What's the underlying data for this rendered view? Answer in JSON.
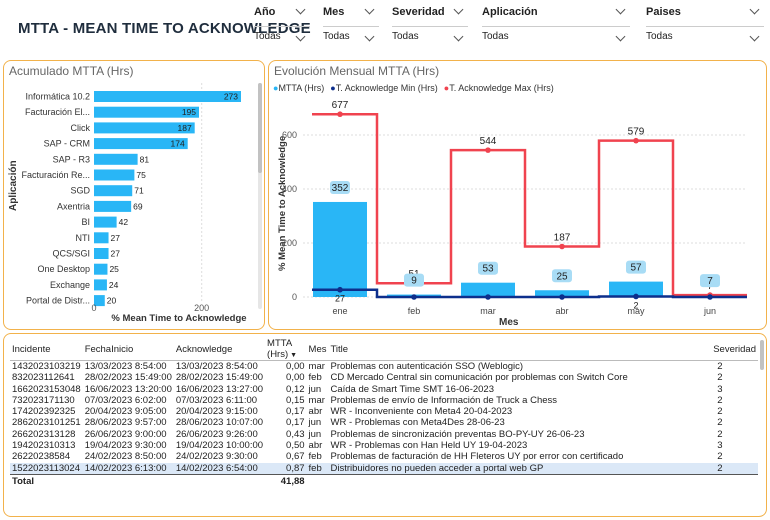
{
  "header": {
    "title": "MTTA - MEAN TIME TO ACKNOWLEDGE"
  },
  "filters": [
    {
      "label": "Año",
      "value": "Todas"
    },
    {
      "label": "Mes",
      "value": "Todas"
    },
    {
      "label": "Severidad",
      "value": "Todas"
    },
    {
      "label": "Aplicación",
      "value": "Todas"
    },
    {
      "label": "Paises",
      "value": "Todas"
    }
  ],
  "left_chart": {
    "title": "Acumulado MTTA (Hrs)",
    "ylabel": "Aplicación",
    "xlabel": "% Mean Time to Acknowledge",
    "ticks": [
      "0",
      "200"
    ]
  },
  "right_chart": {
    "title": "Evolución Mensual MTTA (Hrs)",
    "legend": [
      "MTTA (Hrs)",
      "T. Acknowledge Min (Hrs)",
      "T. Acknowledge Max (Hrs)"
    ],
    "ylabel": "% Mean Time to Acknowledge",
    "xlabel": "Mes",
    "yticks": [
      "0",
      "200",
      "400",
      "600"
    ]
  },
  "chart_data": [
    {
      "type": "bar",
      "orientation": "horizontal",
      "title": "Acumulado MTTA (Hrs)",
      "ylabel": "Aplicación",
      "xlabel": "% Mean Time to Acknowledge",
      "categories": [
        "Informática 10.2",
        "Facturación El...",
        "Click",
        "SAP - CRM",
        "SAP - R3",
        "Facturación Re...",
        "SGD",
        "Axentria",
        "BI",
        "NTI",
        "QCS/SGI",
        "One Desktop",
        "Exchange",
        "Portal de Distr..."
      ],
      "values": [
        273,
        195,
        187,
        174,
        81,
        75,
        71,
        69,
        42,
        27,
        27,
        25,
        24,
        20
      ],
      "xlim": [
        0,
        280
      ],
      "color": "#29b6f6"
    },
    {
      "type": "bar",
      "title": "Evolución Mensual MTTA (Hrs)",
      "xlabel": "Mes",
      "ylabel": "% Mean Time to Acknowledge",
      "categories": [
        "ene",
        "feb",
        "mar",
        "abr",
        "may",
        "jun"
      ],
      "series": [
        {
          "name": "MTTA (Hrs)",
          "type": "bar",
          "values": [
            352,
            9,
            53,
            25,
            57,
            7
          ],
          "color": "#29b6f6"
        },
        {
          "name": "T. Acknowledge Min (Hrs)",
          "type": "line",
          "values": [
            27,
            0,
            0,
            0,
            2,
            0
          ],
          "color": "#0d2f8c"
        },
        {
          "name": "T. Acknowledge Max (Hrs)",
          "type": "line",
          "values": [
            677,
            51,
            544,
            187,
            579,
            7
          ],
          "color": "#f0434f"
        }
      ],
      "ylim": [
        0,
        700
      ]
    }
  ],
  "table": {
    "headers": [
      "Incidente",
      "FechaInicio",
      "Acknowledge",
      "MTTA (Hrs)",
      "Mes",
      "Title",
      "Severidad"
    ],
    "rows": [
      [
        "1432023103219",
        "13/03/2023 8:54:00",
        "13/03/2023 8:54:00",
        "0,00",
        "mar",
        "Problemas con autenticación SSO (Weblogic)",
        "2"
      ],
      [
        "832023112641",
        "28/02/2023 15:49:00",
        "28/02/2023 15:49:00",
        "0,00",
        "feb",
        "CD Mercado Central sin comunicación por problemas con Switch Core",
        "2"
      ],
      [
        "1662023153048",
        "16/06/2023 13:20:00",
        "16/06/2023 13:27:00",
        "0,12",
        "jun",
        "Caída de Smart Time SMT 16-06-2023",
        "3"
      ],
      [
        "732023171130",
        "07/03/2023 6:02:00",
        "07/03/2023 6:11:00",
        "0,15",
        "mar",
        "Problemas de envío de Información de Truck a Chess",
        "2"
      ],
      [
        "174202392325",
        "20/04/2023 9:05:00",
        "20/04/2023 9:15:00",
        "0,17",
        "abr",
        "WR - Inconveniente con Meta4 20-04-2023",
        "2"
      ],
      [
        "2862023101251",
        "28/06/2023 9:57:00",
        "28/06/2023 10:07:00",
        "0,17",
        "jun",
        "WR - Problemas con Meta4Des 28-06-23",
        "2"
      ],
      [
        "266202313128",
        "26/06/2023 9:00:00",
        "26/06/2023 9:26:00",
        "0,43",
        "jun",
        "Problemas de sincronización preventas BO-PY-UY 26-06-23",
        "2"
      ],
      [
        "194202310313",
        "19/04/2023 9:30:00",
        "19/04/2023 10:00:00",
        "0,50",
        "abr",
        "WR - Problemas con Han Held UY 19-04-2023",
        "3"
      ],
      [
        "26220238584",
        "24/02/2023 8:50:00",
        "24/02/2023 9:30:00",
        "0,67",
        "feb",
        "Problemas de facturación de HH Fleteros UY por error con certificado",
        "2"
      ],
      [
        "1522023113024",
        "14/02/2023 6:13:00",
        "14/02/2023 6:54:00",
        "0,87",
        "feb",
        "Distribuidores no pueden acceder a portal web GP",
        "2"
      ]
    ],
    "total_label": "Total",
    "total_value": "41,88"
  }
}
